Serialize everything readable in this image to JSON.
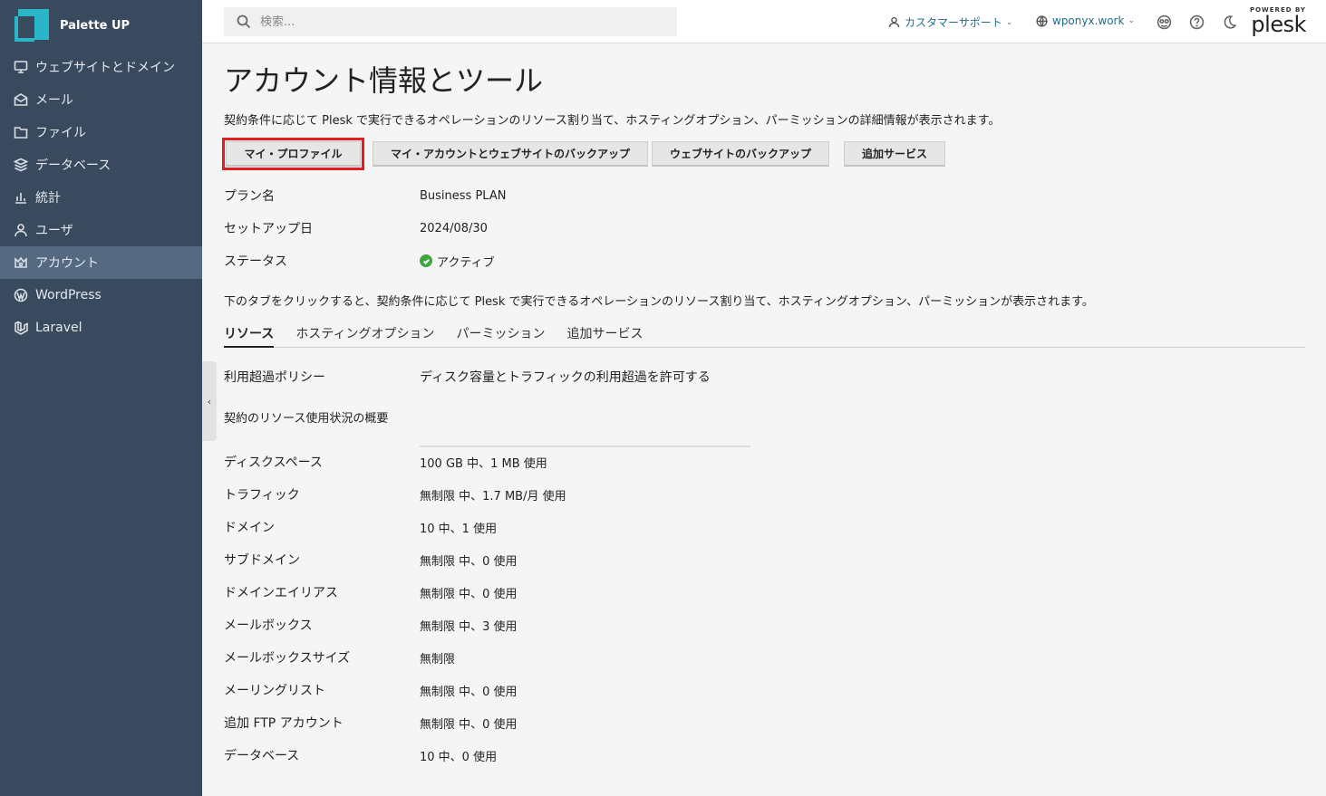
{
  "sidebar": {
    "brand": "Palette UP",
    "items": [
      {
        "label": "ウェブサイトとドメイン",
        "icon": "monitor-icon"
      },
      {
        "label": "メール",
        "icon": "mail-icon"
      },
      {
        "label": "ファイル",
        "icon": "folder-icon"
      },
      {
        "label": "データベース",
        "icon": "database-icon"
      },
      {
        "label": "統計",
        "icon": "stats-icon"
      },
      {
        "label": "ユーザ",
        "icon": "user-icon"
      },
      {
        "label": "アカウント",
        "icon": "account-icon",
        "active": true
      },
      {
        "label": "WordPress",
        "icon": "wordpress-icon"
      },
      {
        "label": "Laravel",
        "icon": "laravel-icon"
      }
    ]
  },
  "header": {
    "search_placeholder": "検索...",
    "support_label": "カスタマーサポート",
    "domain_label": "wponyx.work",
    "powered_by": "POWERED BY",
    "plesk": "plesk"
  },
  "page": {
    "title": "アカウント情報とツール",
    "description": "契約条件に応じて Plesk で実行できるオペレーションのリソース割り当て、ホスティングオプション、パーミッションの詳細情報が表示されます。",
    "buttons": {
      "profile": "マイ・プロファイル",
      "account_backup": "マイ・アカウントとウェブサイトのバックアップ",
      "website_backup": "ウェブサイトのバックアップ",
      "additional_services": "追加サービス"
    },
    "info": [
      {
        "label": "プラン名",
        "value": "Business PLAN"
      },
      {
        "label": "セットアップ日",
        "value": "2024/08/30"
      },
      {
        "label": "ステータス",
        "value": "アクティブ"
      }
    ],
    "tabs_description": "下のタブをクリックすると、契約条件に応じて Plesk で実行できるオペレーションのリソース割り当て、ホスティングオプション、パーミッションが表示されます。",
    "tabs": [
      "リソース",
      "ホスティングオプション",
      "パーミッション",
      "追加サービス"
    ],
    "overuse_label": "利用超過ポリシー",
    "overuse_value": "ディスク容量とトラフィックの利用超過を許可する",
    "summary_heading": "契約のリソース使用状況の概要",
    "resources": [
      {
        "label": "ディスクスペース",
        "value": "100 GB 中、1 MB 使用"
      },
      {
        "label": "トラフィック",
        "value": "無制限 中、1.7 MB/月 使用"
      },
      {
        "label": "ドメイン",
        "value": "10 中、1 使用"
      },
      {
        "label": "サブドメイン",
        "value": "無制限 中、0 使用"
      },
      {
        "label": "ドメインエイリアス",
        "value": "無制限 中、0 使用"
      },
      {
        "label": "メールボックス",
        "value": "無制限 中、3 使用"
      },
      {
        "label": "メールボックスサイズ",
        "value": "無制限"
      },
      {
        "label": "メーリングリスト",
        "value": "無制限 中、0 使用"
      },
      {
        "label": "追加 FTP アカウント",
        "value": "無制限 中、0 使用"
      },
      {
        "label": "データベース",
        "value": "10 中、0 使用"
      }
    ]
  }
}
